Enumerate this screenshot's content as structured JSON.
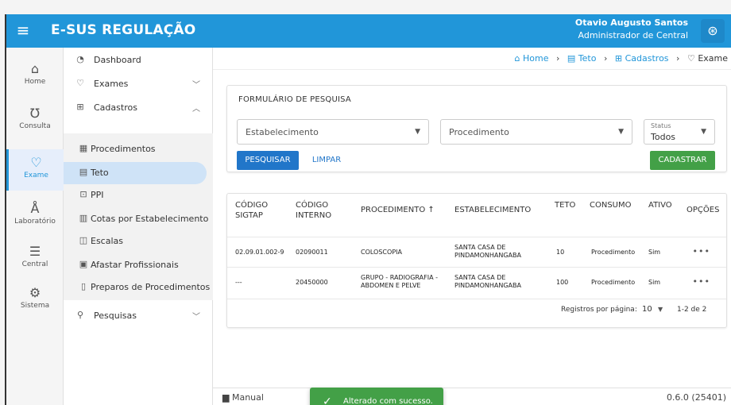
{
  "header": {
    "app_title": "E-SUS REGULAÇÃO",
    "user_name": "Otavio Augusto Santos",
    "user_role": "Administrador de Central",
    "menu_icon": "hamburger-icon",
    "user_icon": "user-circle-icon"
  },
  "rail": [
    {
      "label": "Home",
      "icon": "home-icon"
    },
    {
      "label": "Consulta",
      "icon": "stethoscope-icon"
    },
    {
      "label": "Exame",
      "icon": "heart-pulse-icon"
    },
    {
      "label": "Laboratório",
      "icon": "flask-icon"
    },
    {
      "label": "Central",
      "icon": "server-icon"
    },
    {
      "label": "Sistema",
      "icon": "gear-icon"
    }
  ],
  "sidebar": {
    "dashboard": "Dashboard",
    "exames": "Exames",
    "cadastros": "Cadastros",
    "sub": [
      "Procedimentos",
      "Teto",
      "PPI",
      "Cotas por Estabelecimento",
      "Escalas",
      "Afastar Profissionais",
      "Preparos de Procedimentos"
    ],
    "pesquisas": "Pesquisas"
  },
  "breadcrumb": {
    "home": "Home",
    "teto": "Teto",
    "cadastros": "Cadastros",
    "exame": "Exame"
  },
  "form": {
    "title": "FORMULÁRIO DE PESQUISA",
    "estabelecimento": "Estabelecimento",
    "procedimento": "Procedimento",
    "status_label": "Status",
    "status_value": "Todos",
    "search_btn": "PESQUISAR",
    "clear_btn": "LIMPAR",
    "create_btn": "CADASTRAR"
  },
  "table": {
    "headers": [
      "CÓDIGO SIGTAP",
      "CÓDIGO INTERNO",
      "PROCEDIMENTO ↑",
      "ESTABELECIMENTO",
      "TETO",
      "CONSUMO",
      "ATIVO",
      "OPÇÕES"
    ],
    "rows": [
      [
        "02.09.01.002-9",
        "02090011",
        "COLOSCOPIA",
        "SANTA CASA DE PINDAMONHANGABA",
        "10",
        "Procedimento",
        "Sim",
        "•••"
      ],
      [
        "---",
        "20450000",
        "GRUPO - RADIOGRAFIA - ABDOMEN E PELVE",
        "SANTA CASA DE PINDAMONHANGABA",
        "100",
        "Procedimento",
        "Sim",
        "•••"
      ]
    ],
    "per_page_label": "Registros por página:",
    "per_page_value": "10",
    "range": "1-2 de 2"
  },
  "footer": {
    "manual": "Manual",
    "version": "0.6.0 (25401)"
  },
  "toast": {
    "message": "Alterado com sucesso."
  },
  "colors": {
    "primary": "#2196d9",
    "success": "#43a047",
    "button": "#2176c9"
  }
}
